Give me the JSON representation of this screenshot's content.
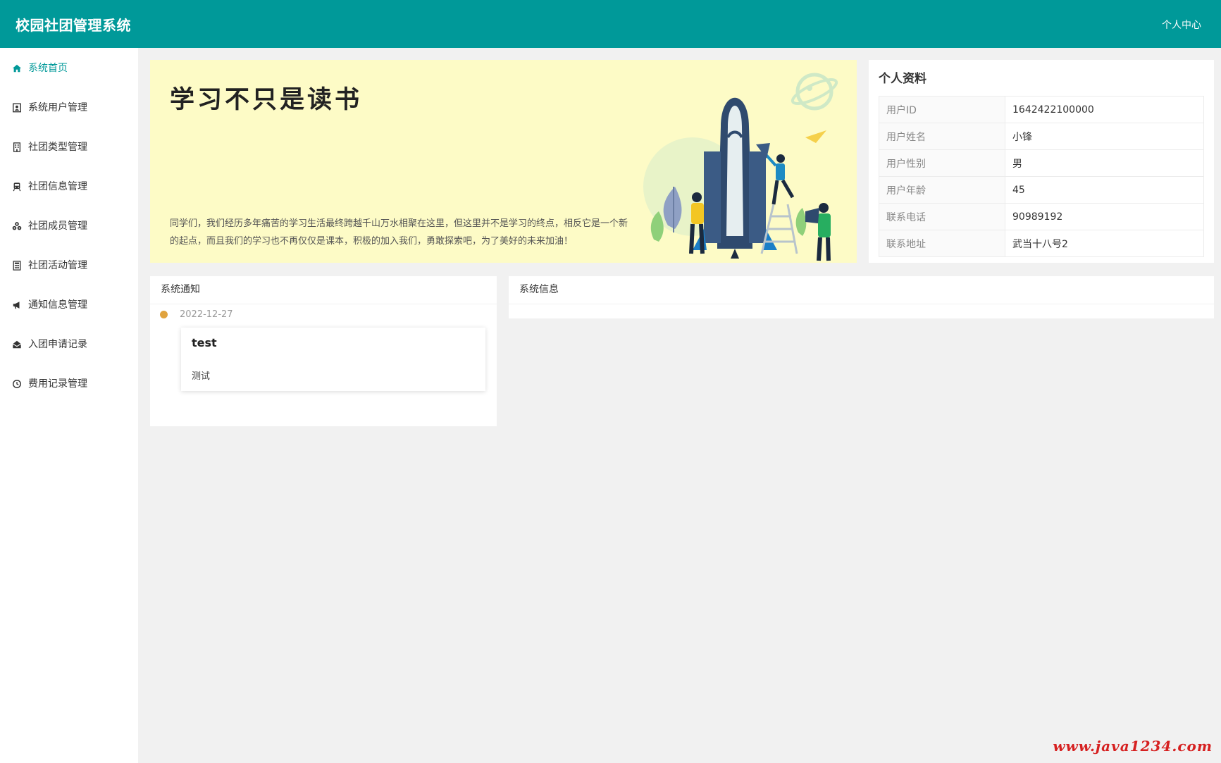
{
  "header": {
    "title": "校园社团管理系统",
    "user_center": "个人中心",
    "background_color": "#009999"
  },
  "sidebar": {
    "items": [
      {
        "label": "系统首页",
        "icon": "home-icon",
        "active": true
      },
      {
        "label": "系统用户管理",
        "icon": "user-card-icon"
      },
      {
        "label": "社团类型管理",
        "icon": "building-icon"
      },
      {
        "label": "社团信息管理",
        "icon": "train-icon"
      },
      {
        "label": "社团成员管理",
        "icon": "group-icon"
      },
      {
        "label": "社团活动管理",
        "icon": "calculator-icon"
      },
      {
        "label": "通知信息管理",
        "icon": "megaphone-icon"
      },
      {
        "label": "入团申请记录",
        "icon": "envelope-open-icon"
      },
      {
        "label": "费用记录管理",
        "icon": "clock-icon"
      }
    ]
  },
  "banner": {
    "title": "学习不只是读书",
    "text": "同学们，我们经历多年痛苦的学习生活最终跨越千山万水相聚在这里，但这里并不是学习的终点，相反它是一个新的起点，而且我们的学习也不再仅仅是课本，积极的加入我们，勇敢探索吧，为了美好的未来加油！",
    "background_color": "#fdfbc6"
  },
  "profile": {
    "title": "个人资料",
    "rows": [
      {
        "key": "用户ID",
        "value": "1642422100000"
      },
      {
        "key": "用户姓名",
        "value": "小锋"
      },
      {
        "key": "用户性别",
        "value": "男"
      },
      {
        "key": "用户年龄",
        "value": "45"
      },
      {
        "key": "联系电话",
        "value": "90989192"
      },
      {
        "key": "联系地址",
        "value": "武当十八号2"
      }
    ]
  },
  "notices": {
    "title": "系统通知",
    "items": [
      {
        "date": "2022-12-27",
        "title": "test",
        "content": "测试"
      }
    ],
    "dot_color": "#e0a33e"
  },
  "sysinfo": {
    "title": "系统信息"
  },
  "watermark": "www.java1234.com"
}
